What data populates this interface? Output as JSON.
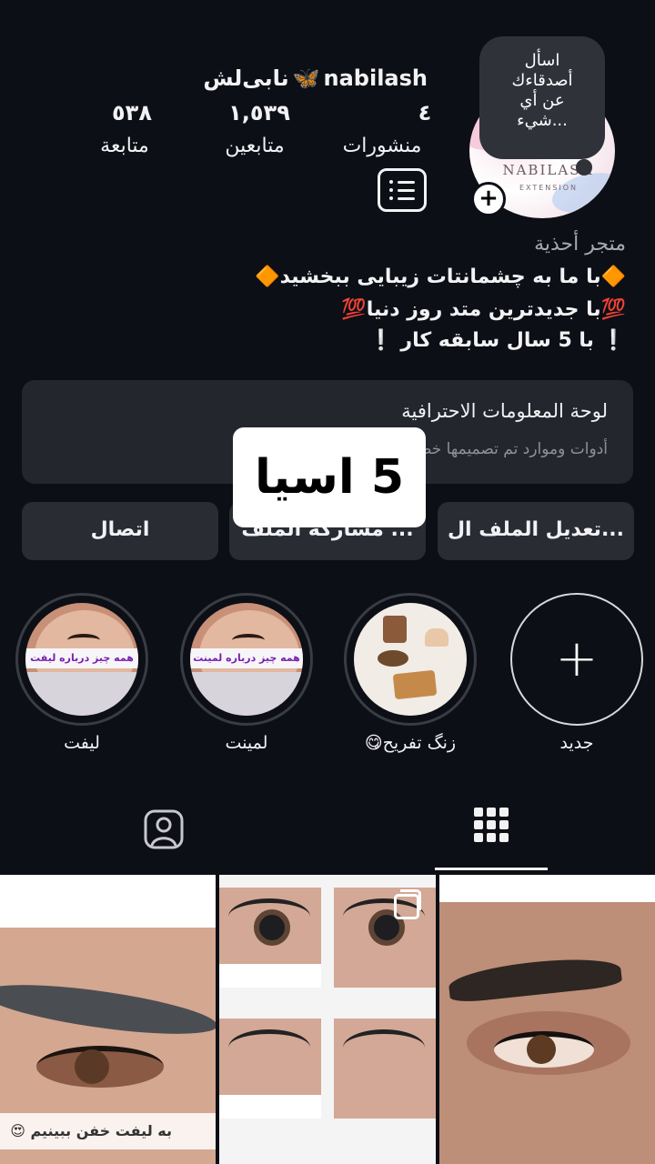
{
  "profile": {
    "username": "nabilash",
    "display_name": "نابی‌لش",
    "butterfly": "🦋",
    "note": "اسأل\nأصدقاءك\nعن أي\nشيء...",
    "avatar_brand": "NABILASH",
    "avatar_brand_sub": "EXTENSION",
    "add_badge": "+",
    "stats": {
      "posts_value": "٤",
      "posts_label": "منشورات",
      "followers_value": "١,٥٣٩",
      "followers_label": "متابعين",
      "following_value": "٥٣٨",
      "following_label": "متابعة"
    }
  },
  "bio": {
    "category": "متجر أحذية",
    "line1": "🔶با ما به چشمانتات زیبایی ببخشید🔶",
    "line2": "💯با جدیدترین متد روز دنیا💯",
    "line3": "❕ با 5 سال سابقه کار ❕"
  },
  "dashboard": {
    "title": "لوحة المعلومات الاحترافية",
    "subtitle": "أدوات وموارد تم تصميمها خصيصًا للأنشطة التجارية."
  },
  "actions": {
    "edit": "تعديل الملف ال...",
    "share": "مشاركة الملف ...",
    "contact": "اتصال"
  },
  "overlay_sticker": "5 اسيا",
  "highlights": [
    {
      "label": "جديد"
    },
    {
      "label": "زنگ تفریح😋"
    },
    {
      "label": "لمینت",
      "tag": "همه چیز درباره لمینت"
    },
    {
      "label": "لیفت",
      "tag": "همه چیز درباره لیفت"
    }
  ],
  "posts": {
    "post1_caption": "به لیفت خفن ببینیم 😍"
  },
  "icons": {
    "menu": "menu-icon",
    "grid": "grid-icon",
    "tagged": "tagged-person-icon",
    "multi": "carousel-icon",
    "plus": "plus-icon"
  },
  "colors": {
    "background": "#0d0f16",
    "card": "#24262e",
    "button": "#2a2c34",
    "accent_butterfly": "#53b3ff"
  }
}
